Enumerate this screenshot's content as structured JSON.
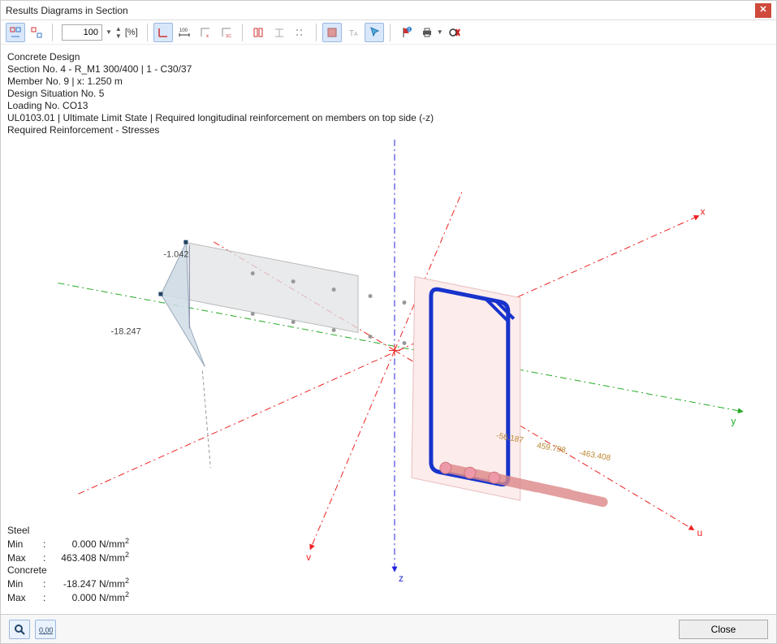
{
  "window": {
    "title": "Results Diagrams in Section"
  },
  "toolbar": {
    "zoom_value": "100",
    "percent_label": "[%]"
  },
  "info": {
    "line1": "Concrete Design",
    "line2": "Section No. 4 - R_M1 300/400 | 1 - C30/37",
    "line3": "Member No. 9 | x: 1.250 m",
    "line4": "Design Situation No. 5",
    "line5": "Loading No. CO13",
    "line6": "UL0103.01 | Ultimate Limit State | Required longitudinal reinforcement on members on top side (-z)",
    "line7": "Required Reinforcement - Stresses"
  },
  "diagram": {
    "axis_x": "x",
    "axis_y": "y",
    "axis_z": "z",
    "axis_u": "u",
    "axis_v": "v",
    "val_top": "-1.042",
    "val_left": "-18.247",
    "val_b1": "-56.187",
    "val_b2": "459.798",
    "val_b3": "-463.408"
  },
  "legend": {
    "steel_label": "Steel",
    "concrete_label": "Concrete",
    "min_label": "Min",
    "max_label": "Max",
    "unit_html": "N/mm",
    "steel_min": "0.000",
    "steel_max": "463.408",
    "concrete_min": "-18.247",
    "concrete_max": "0.000"
  },
  "footer": {
    "close_label": "Close"
  },
  "chart_data": {
    "type": "engineering-section-diagram",
    "title": "Required Reinforcement - Stresses",
    "units": "N/mm²",
    "series": [
      {
        "name": "Steel",
        "min": 0.0,
        "max": 463.408
      },
      {
        "name": "Concrete",
        "min": -18.247,
        "max": 0.0
      }
    ],
    "concrete_profile_values": [
      -1.042,
      -18.247
    ],
    "rebar_values": [
      -56.187,
      459.798,
      -463.408
    ],
    "axes": [
      "x",
      "y",
      "z",
      "u",
      "v"
    ]
  }
}
